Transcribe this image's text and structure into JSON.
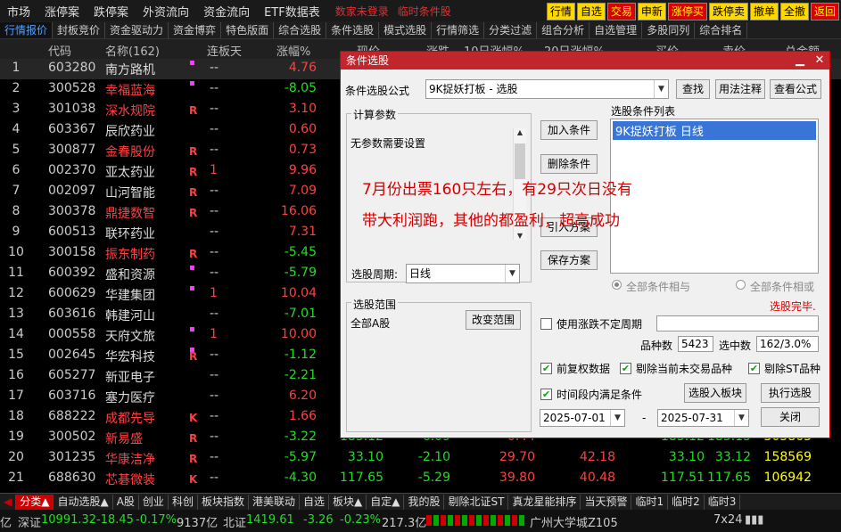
{
  "menu": {
    "items": [
      "市场",
      "涨停案",
      "跌停案",
      "外资流向",
      "资金流向",
      "ETF数据表"
    ],
    "warn1": "数家未登录",
    "warn2": "临时条件股"
  },
  "top_buttons": [
    "行情",
    "自选",
    "交易",
    "申新",
    "涨停买",
    "跌停卖",
    "撤单",
    "全撤",
    "返回"
  ],
  "tabs": [
    "行情报价",
    "封板竞价",
    "资金驱动力",
    "资金博弈",
    "特色版面",
    "综合选股",
    "条件选股",
    "模式选股",
    "行情筛选",
    "分类过滤",
    "组合分析",
    "自选管理",
    "多股同列",
    "综合排名"
  ],
  "columns": [
    "代码",
    "名称(162)",
    "连板天",
    "涨幅%",
    "现价",
    "涨跌",
    "10日涨幅%",
    "20日涨幅%",
    "买价",
    "卖价",
    "总金额"
  ],
  "rows": [
    {
      "i": "1",
      "code": "603280",
      "name": "南方路机",
      "red": false,
      "flag": "▪",
      "r": "",
      "streak": "--",
      "chg": "4.76",
      "dir": "up"
    },
    {
      "i": "2",
      "code": "300528",
      "name": "幸福蓝海",
      "red": true,
      "flag": "▪",
      "r": "",
      "streak": "--",
      "chg": "-8.05",
      "dir": "dn"
    },
    {
      "i": "3",
      "code": "301038",
      "name": "深水规院",
      "red": true,
      "flag": "",
      "r": "R",
      "streak": "--",
      "chg": "3.10",
      "dir": "up"
    },
    {
      "i": "4",
      "code": "603367",
      "name": "辰欣药业",
      "red": false,
      "flag": "",
      "r": "",
      "streak": "--",
      "chg": "0.60",
      "dir": "up"
    },
    {
      "i": "5",
      "code": "300877",
      "name": "金春股份",
      "red": true,
      "flag": "",
      "r": "R",
      "streak": "--",
      "chg": "0.73",
      "dir": "up"
    },
    {
      "i": "6",
      "code": "002370",
      "name": "亚太药业",
      "red": false,
      "flag": "",
      "r": "R",
      "streak": "1",
      "chg": "9.96",
      "dir": "up"
    },
    {
      "i": "7",
      "code": "002097",
      "name": "山河智能",
      "red": false,
      "flag": "",
      "r": "R",
      "streak": "--",
      "chg": "7.09",
      "dir": "up"
    },
    {
      "i": "8",
      "code": "300378",
      "name": "鼎捷数智",
      "red": true,
      "flag": "",
      "r": "R",
      "streak": "--",
      "chg": "16.06",
      "dir": "up"
    },
    {
      "i": "9",
      "code": "600513",
      "name": "联环药业",
      "red": false,
      "flag": "",
      "r": "",
      "streak": "--",
      "chg": "7.31",
      "dir": "up"
    },
    {
      "i": "10",
      "code": "300158",
      "name": "振东制药",
      "red": true,
      "flag": "",
      "r": "R",
      "streak": "--",
      "chg": "-5.45",
      "dir": "dn"
    },
    {
      "i": "11",
      "code": "600392",
      "name": "盛和资源",
      "red": false,
      "flag": "▪",
      "r": "",
      "streak": "--",
      "chg": "-5.79",
      "dir": "dn"
    },
    {
      "i": "12",
      "code": "600629",
      "name": "华建集团",
      "red": false,
      "flag": "▪",
      "r": "",
      "streak": "1",
      "chg": "10.04",
      "dir": "up"
    },
    {
      "i": "13",
      "code": "603616",
      "name": "韩建河山",
      "red": false,
      "flag": "",
      "r": "",
      "streak": "--",
      "chg": "-7.01",
      "dir": "dn"
    },
    {
      "i": "14",
      "code": "000558",
      "name": "天府文旅",
      "red": false,
      "flag": "▪",
      "r": "",
      "streak": "1",
      "chg": "10.00",
      "dir": "up"
    },
    {
      "i": "15",
      "code": "002645",
      "name": "华宏科技",
      "red": false,
      "flag": "▪",
      "r": "R",
      "streak": "--",
      "chg": "-1.12",
      "dir": "dn"
    },
    {
      "i": "16",
      "code": "605277",
      "name": "新亚电子",
      "red": false,
      "flag": "",
      "r": "",
      "streak": "--",
      "chg": "-2.21",
      "dir": "dn"
    },
    {
      "i": "17",
      "code": "603716",
      "name": "塞力医疗",
      "red": false,
      "flag": "",
      "r": "",
      "streak": "--",
      "chg": "6.20",
      "dir": "up"
    },
    {
      "i": "18",
      "code": "688222",
      "name": "成都先导",
      "red": true,
      "flag": "",
      "r": "K",
      "streak": "--",
      "chg": "1.66",
      "dir": "up"
    },
    {
      "i": "19",
      "code": "300502",
      "name": "新易盛",
      "red": true,
      "flag": "",
      "r": "R",
      "streak": "--",
      "chg": "-3.22",
      "dir": "dn",
      "p": "183.12",
      "pc": "-6.09",
      "c10": "0.44",
      "c20": "",
      "buy": "183.12",
      "sell": "183.15",
      "amt": "305863",
      "c10dir": "up",
      "c20dir": "up"
    },
    {
      "i": "20",
      "code": "301235",
      "name": "华康洁净",
      "red": true,
      "flag": "",
      "r": "R",
      "streak": "--",
      "chg": "-5.97",
      "dir": "dn",
      "p": "33.10",
      "pc": "-2.10",
      "c10": "29.70",
      "c20": "42.18",
      "buy": "33.10",
      "sell": "33.12",
      "amt": "158569",
      "c10dir": "up",
      "c20dir": "up"
    },
    {
      "i": "21",
      "code": "688630",
      "name": "芯碁微装",
      "red": true,
      "flag": "",
      "r": "K",
      "streak": "--",
      "chg": "-4.30",
      "dir": "dn",
      "p": "117.65",
      "pc": "-5.29",
      "c10": "39.80",
      "c20": "40.48",
      "buy": "117.51",
      "sell": "117.65",
      "amt": "106942",
      "c10dir": "up",
      "c20dir": "up"
    }
  ],
  "dialog": {
    "title": "条件选股",
    "formula_label": "条件选股公式",
    "formula_value": "9K捉妖打板  -  选股",
    "btn_find": "查找",
    "btn_usage": "用法注释",
    "btn_view": "查看公式",
    "calc_params": "计算参数",
    "no_params": "无参数需要设置",
    "btn_add": "加入条件",
    "btn_delete": "删除条件",
    "btn_import": "引入方案",
    "btn_save": "保存方案",
    "list_label": "选股条件列表",
    "list_item": "9K捉妖打板  日线",
    "period_label": "选股周期:",
    "period_value": "日线",
    "radio_and": "全部条件相与",
    "radio_or": "全部条件相或",
    "done": "选股完毕.",
    "scope_label": "选股范围",
    "scope_value": "全部A股",
    "btn_change_scope": "改变范围",
    "use_period": "使用涨跌不定周期",
    "count_label": "品种数",
    "count_value": "5423",
    "sel_label": "选中数",
    "sel_value": "162/3.0%",
    "chk_fq": "前复权数据",
    "chk_exclude_notrade": "剔除当前未交易品种",
    "chk_exclude_st": "剔除ST品种",
    "chk_period": "时间段内满足条件",
    "btn_to_block": "选股入板块",
    "btn_run": "执行选股",
    "date_from": "2025-07-01",
    "date_to": "2025-07-31",
    "dash": "-",
    "btn_close": "关闭"
  },
  "overlay": {
    "line1": "7月份出票160只左右，有29只次日没有",
    "line2": "带大利润跑，其他的都盈利，超高成功"
  },
  "bottom_tabs": [
    "分类▲",
    "自动选股▲",
    "A股",
    "创业",
    "科创",
    "板块指数",
    "港美联动",
    "自选",
    "板块▲",
    "自定▲",
    "我的股",
    "剔除北证ST",
    "真龙星能排序",
    "当天预警",
    "临时1",
    "临时2",
    "临时3"
  ],
  "status": {
    "prefix": "亿",
    "sz_label": "深证",
    "sz_val": "10991.32",
    "sz_chg": "-18.45",
    "sz_pct": "-0.17%",
    "sz_amt": "9137亿",
    "bz_label": "北证",
    "bz_val": "1419.61",
    "bz_chg": "-3.26",
    "bz_pct": "-0.23%",
    "bz_amt": "217.3亿",
    "location": "广州大学城Z105",
    "mode": "7x24"
  },
  "colors": {
    "up": "#ff4040",
    "down": "#22dd22",
    "accent": "#c0262c"
  }
}
